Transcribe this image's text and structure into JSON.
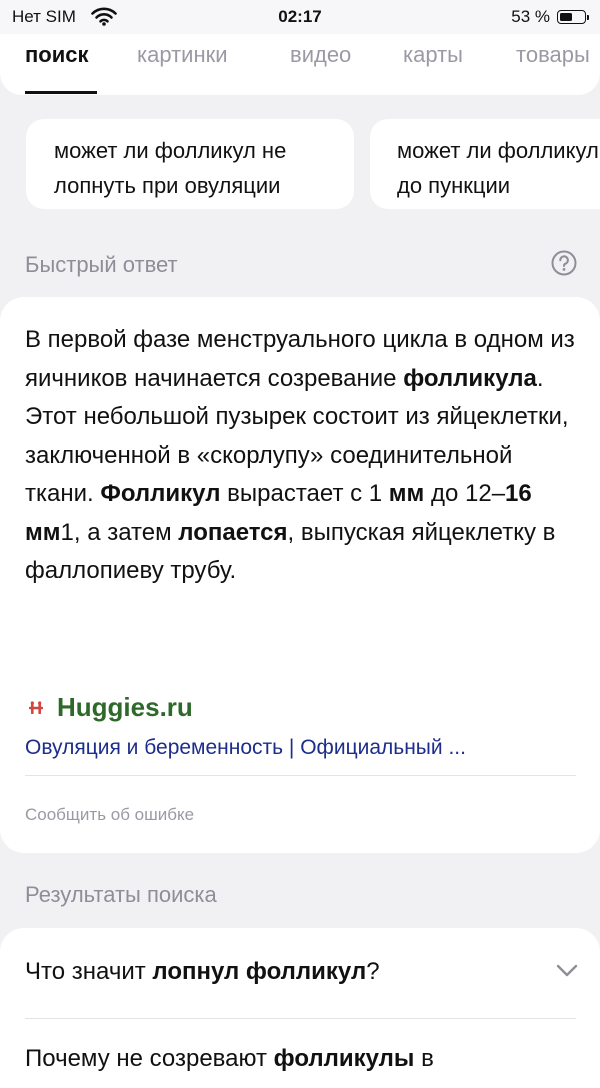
{
  "status_bar": {
    "carrier": "Нет SIM",
    "time": "02:17",
    "battery_percent_label": "53 %",
    "battery_level": 0.53
  },
  "tabs": [
    {
      "label": "поиск",
      "active": true
    },
    {
      "label": "картинки",
      "active": false
    },
    {
      "label": "видео",
      "active": false
    },
    {
      "label": "карты",
      "active": false
    },
    {
      "label": "товары",
      "active": false
    }
  ],
  "suggestions": [
    {
      "line1": "может ли фолликул не",
      "line2": "лопнуть при овуляции"
    },
    {
      "line1": "может ли фолликул",
      "line2": "до пункции"
    }
  ],
  "quick_answer": {
    "header": "Быстрый ответ",
    "help_icon": "question-circle-icon",
    "text": {
      "s1": "В первой фазе менструального цикла в одном из яичников начинается созревание ",
      "b1": "фолликула",
      "s2": ". Этот небольшой пузырек состоит из яйцеклетки, заключенной в «скорлупу» соединительной ткани. ",
      "b2": "Фолликул",
      "s3": " вырастает с 1 ",
      "b3": "мм",
      "s4": " до 12–",
      "b4": "16 мм",
      "s5": "1, а затем ",
      "b5": "лопается",
      "s6": ", выпуская яйцеклетку в фаллопиеву трубу."
    },
    "source_name": "Huggies.ru",
    "source_link": "Овуляция и беременность | Официальный ...",
    "report_label": "Сообщить об ошибке"
  },
  "results": {
    "header": "Результаты поиска",
    "items": [
      {
        "pre": "Что значит ",
        "bold": "лопнул фолликул",
        "post": "?"
      },
      {
        "pre": "Почему не созревают ",
        "bold": "фолликулы",
        "post": " в"
      }
    ]
  },
  "colors": {
    "page_bg": "#f1f1f4",
    "source_green": "#2d6a2a",
    "link_blue": "#1d2d8c",
    "source_icon_red": "#d2463c"
  }
}
